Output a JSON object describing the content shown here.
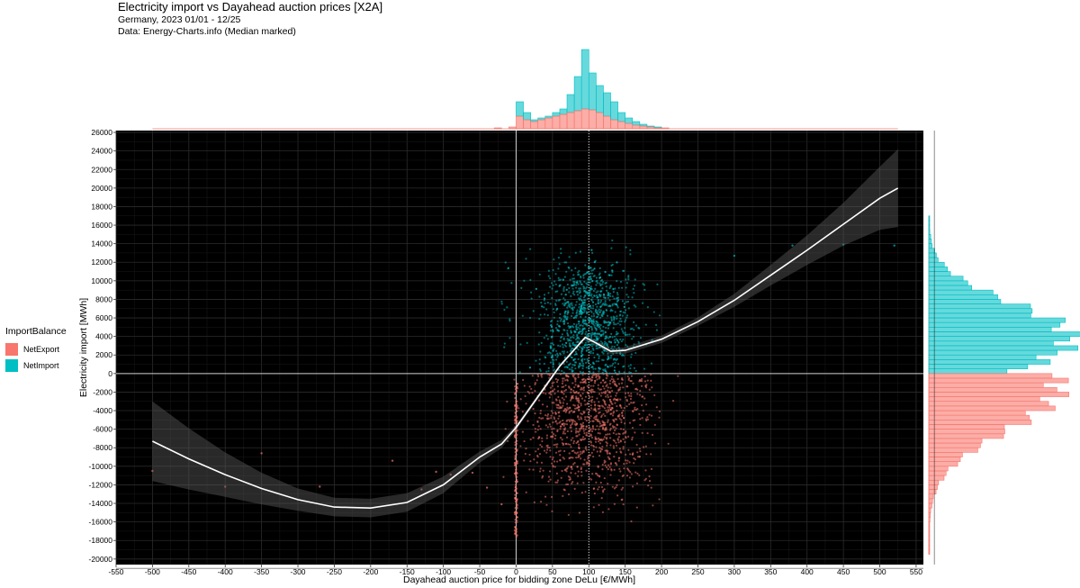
{
  "title": "Electricity import vs Dayahead auction prices [X2A]",
  "subtitle_lines": [
    "Germany, 2023 01/01 - 12/25",
    "Data: Energy-Charts.info (Median marked)"
  ],
  "legend": {
    "title": "ImportBalance",
    "items": [
      {
        "label": "NetExport",
        "color": "#F8766D"
      },
      {
        "label": "NetImport",
        "color": "#00BFC4"
      }
    ]
  },
  "chart_data": {
    "type": "scatter",
    "title": "Electricity import vs Dayahead auction prices [X2A]",
    "xlabel": "Dayahead auction price for bidding zone DeLu [€/MWh]",
    "ylabel": "Electricity import [MWh]",
    "xlim": [
      -550,
      560
    ],
    "ylim": [
      -20600,
      26200
    ],
    "x_ticks": [
      -550,
      -500,
      -450,
      -400,
      -350,
      -300,
      -250,
      -200,
      -150,
      -100,
      -50,
      0,
      50,
      100,
      150,
      200,
      250,
      300,
      350,
      400,
      450,
      500,
      550
    ],
    "y_ticks": [
      26000,
      24000,
      22000,
      20000,
      18000,
      16000,
      14000,
      12000,
      10000,
      8000,
      6000,
      4000,
      2000,
      0,
      -2000,
      -4000,
      -6000,
      -8000,
      -10000,
      -12000,
      -14000,
      -16000,
      -18000,
      -20000
    ],
    "grid": true,
    "background": "#000000",
    "median_price": 100,
    "reference_lines": {
      "x": 0,
      "y": 0
    },
    "series": [
      {
        "name": "NetExport",
        "color": "#F8766D",
        "y_center": -5000,
        "y_spread": 4200,
        "x_center": 100,
        "x_spread": 40
      },
      {
        "name": "NetImport",
        "color": "#00BFC4",
        "y_center": 5500,
        "y_spread": 3500,
        "x_center": 100,
        "x_spread": 30
      }
    ],
    "smooth": {
      "x": [
        -500,
        -450,
        -400,
        -350,
        -300,
        -250,
        -200,
        -150,
        -100,
        -50,
        -20,
        0,
        30,
        60,
        95,
        110,
        130,
        150,
        200,
        250,
        300,
        350,
        400,
        450,
        500,
        525
      ],
      "y": [
        -7300,
        -9200,
        -10900,
        -12400,
        -13600,
        -14400,
        -14500,
        -13900,
        -12000,
        -9000,
        -7600,
        -5800,
        -2500,
        800,
        3900,
        3300,
        2400,
        2500,
        3700,
        5600,
        7900,
        10600,
        13300,
        16100,
        18900,
        20000
      ],
      "ci_width": [
        4300,
        3300,
        2400,
        1700,
        1200,
        1000,
        1000,
        1000,
        900,
        600,
        450,
        300,
        250,
        200,
        200,
        250,
        300,
        350,
        400,
        450,
        700,
        1100,
        1600,
        2300,
        3400,
        4200
      ]
    },
    "x_histogram": {
      "bin_width": 10,
      "bin_centers": [
        -25,
        -5,
        5,
        15,
        25,
        35,
        45,
        55,
        65,
        75,
        85,
        95,
        105,
        115,
        125,
        135,
        145,
        155,
        165,
        175,
        185,
        195,
        205
      ],
      "net_export_height": [
        1,
        2,
        14,
        10,
        8,
        10,
        12,
        14,
        16,
        18,
        20,
        22,
        21,
        18,
        14,
        10,
        8,
        6,
        4,
        3,
        2,
        1,
        1
      ],
      "total_height": [
        1,
        2,
        30,
        18,
        10,
        12,
        14,
        18,
        22,
        38,
        58,
        88,
        62,
        48,
        40,
        30,
        18,
        12,
        8,
        5,
        3,
        2,
        1
      ]
    },
    "y_histogram": {
      "bin_width": 500,
      "net_import": {
        "from": 0,
        "to": 17000
      },
      "net_export": {
        "from": -19500,
        "to": 0
      }
    }
  }
}
